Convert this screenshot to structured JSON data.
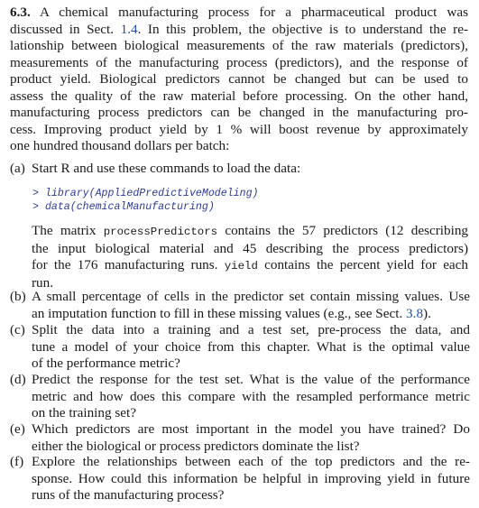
{
  "problem": {
    "number": "6.3.",
    "intro_lines": [
      [
        "A chemical manufacturing process for a pharmaceutical product was"
      ],
      [
        "discussed in Sect.",
        "1.4",
        ". In this problem, the objective is to understand the re-"
      ],
      [
        "lationship between biological measurements of the raw materials (predictors),"
      ],
      [
        "measurements of the manufacturing process (predictors), and the response of"
      ],
      [
        "product yield. Biological predictors cannot be changed but can be used to"
      ],
      [
        "assess the quality of the raw material before processing. On the other hand,"
      ],
      [
        "manufacturing process predictors can be changed in the manufacturing pro-"
      ],
      [
        "cess. Improving product yield by 1 % will boost revenue by approximately"
      ],
      [
        "one hundred thousand dollars per batch:"
      ]
    ]
  },
  "parts": {
    "a": {
      "label": "(a)",
      "text": "Start R and use these commands to load the data:",
      "code_lines": [
        {
          "prompt": ">",
          "code": "library(AppliedPredictiveModeling)"
        },
        {
          "prompt": ">",
          "code": "data(chemicalManufacturing)"
        }
      ],
      "after": {
        "l1_pre": "The matrix",
        "l1_mono": "processPredictors",
        "l1_post": "contains the 57 predictors (12 describing",
        "l2": "the input biological material and 45 describing the process predictors)",
        "l3_pre": "for the 176 manufacturing runs.",
        "l3_mono": "yield",
        "l3_post": "contains the percent yield for each",
        "l4": "run."
      }
    },
    "b": {
      "label": "(b)",
      "lines": [
        "A small percentage of cells in the predictor set contain missing values. Use"
      ],
      "l2_pre": "an imputation function to fill in these missing values (e.g., see Sect.",
      "l2_ref": "3.8",
      "l2_post": ")."
    },
    "c": {
      "label": "(c)",
      "lines": [
        "Split the data into a training and a test set, pre-process the data, and",
        "tune a model of your choice from this chapter. What is the optimal value",
        "of the performance metric?"
      ]
    },
    "d": {
      "label": "(d)",
      "lines": [
        "Predict the response for the test set. What is the value of the performance",
        "metric and how does this compare with the resampled performance metric",
        "on the training set?"
      ]
    },
    "e": {
      "label": "(e)",
      "lines": [
        "Which predictors are most important in the model you have trained? Do",
        "either the biological or process predictors dominate the list?"
      ]
    },
    "f": {
      "label": "(f)",
      "lines": [
        "Explore the relationships between each of the top predictors and the re-",
        "sponse. How could this information be helpful in improving yield in future",
        "runs of the manufacturing process?"
      ]
    }
  }
}
